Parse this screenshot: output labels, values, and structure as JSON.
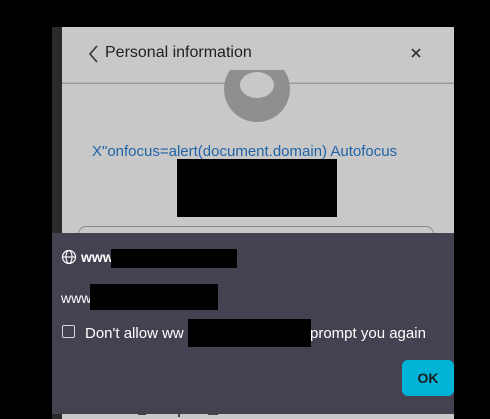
{
  "panel": {
    "title": "Personal information",
    "profile_link": "X\"onfocus=alert(document.domain) Autofocus"
  },
  "dialog": {
    "host_prefix": "www",
    "message_prefix": "www",
    "checkbox_prefix": "Don't allow ww",
    "checkbox_suffix": "prompt you again",
    "checkbox_checked": false,
    "ok_label": "OK"
  },
  "colors": {
    "accent": "#00b3d7",
    "dialog_bg": "#454150",
    "link": "#2064a8",
    "overlay_panel": "#c8c8c8"
  },
  "icons": {
    "back": "chevron-left-icon",
    "close": "close-icon",
    "host": "globe-icon"
  }
}
